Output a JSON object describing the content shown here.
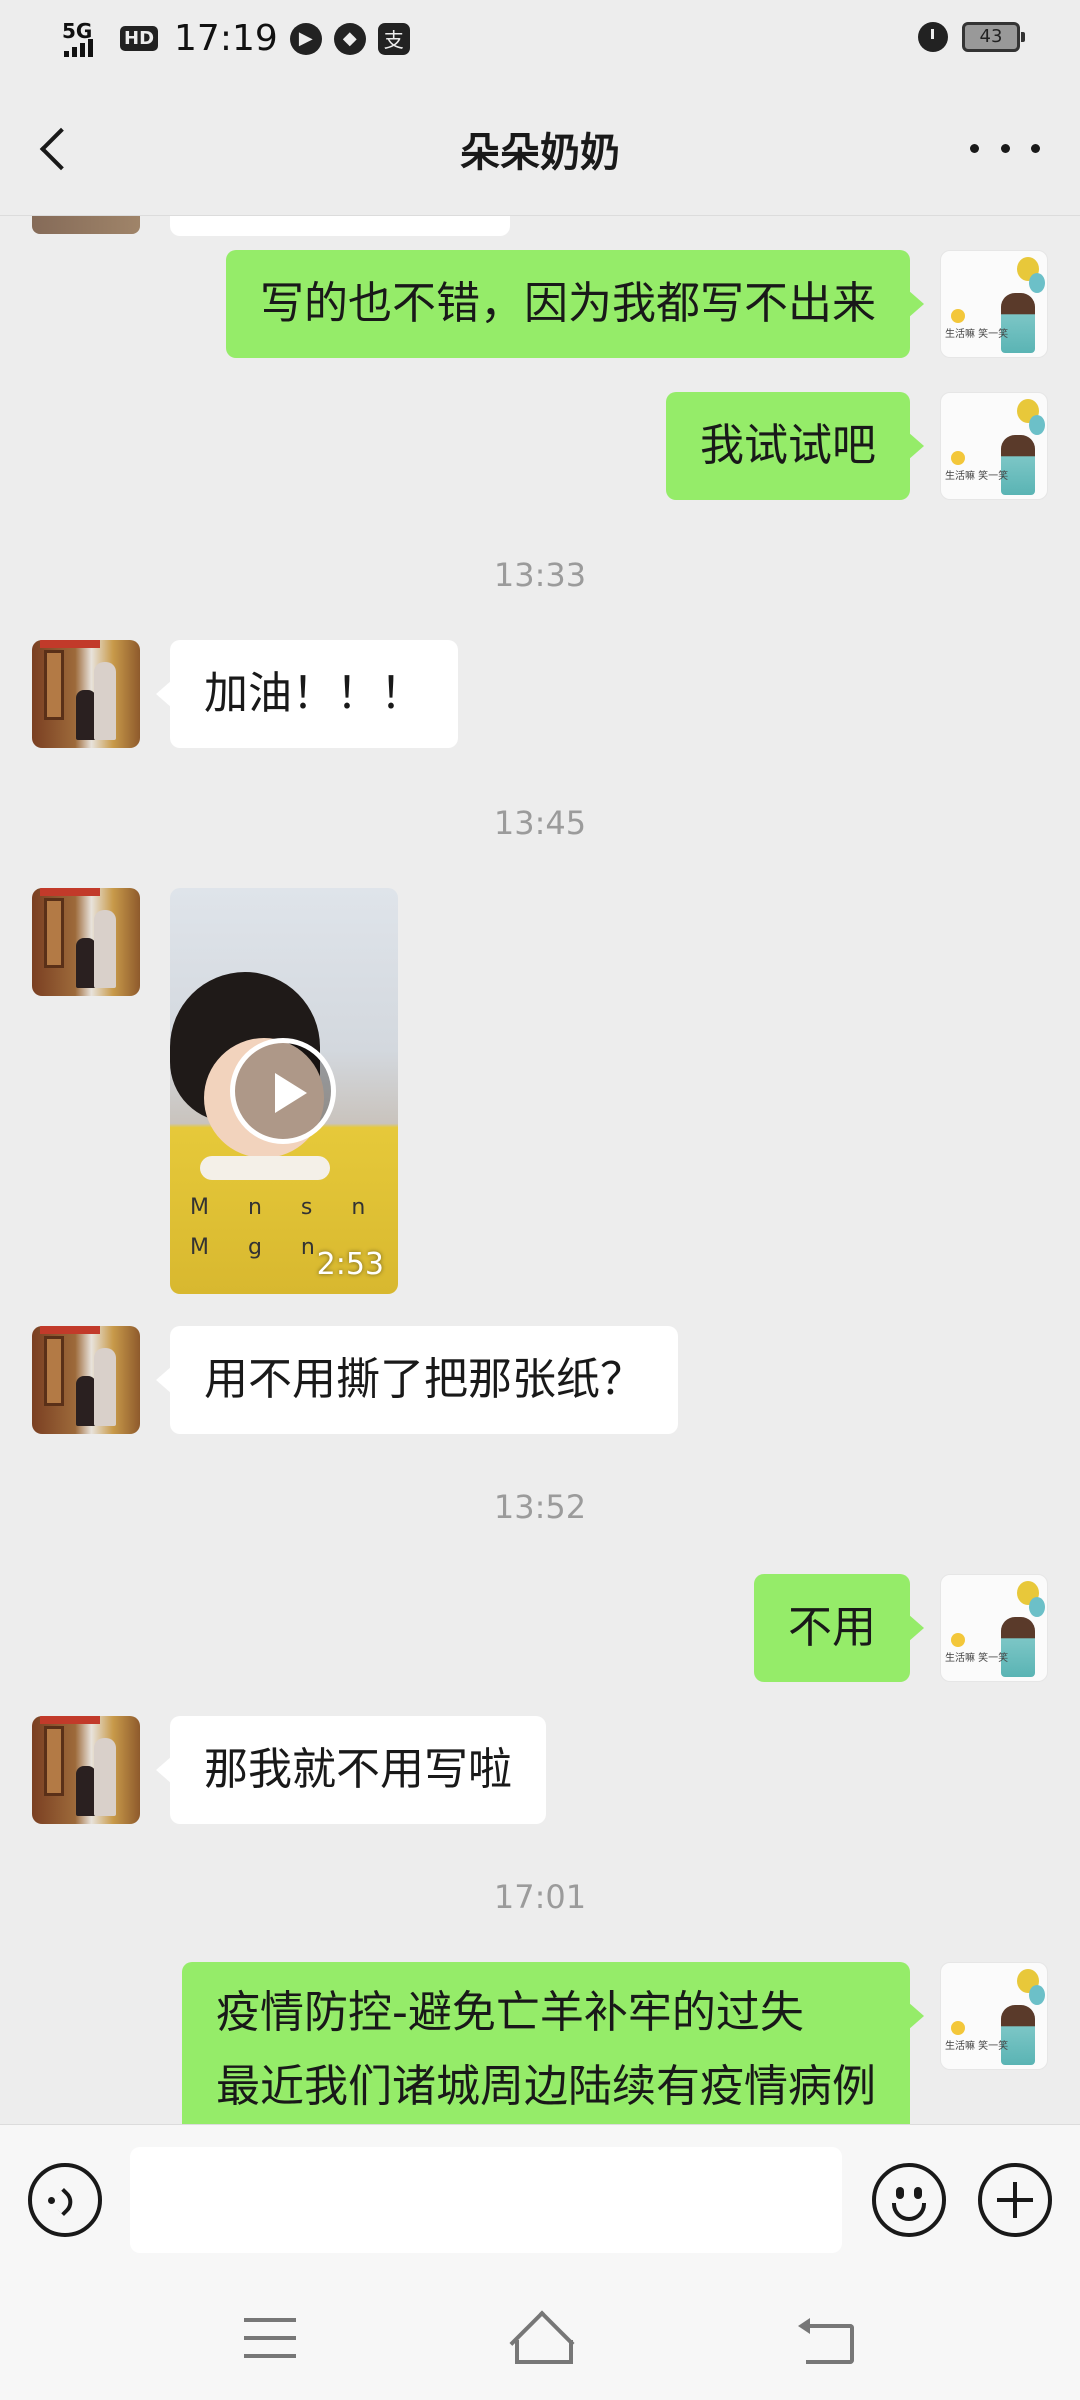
{
  "status_bar": {
    "network": "5G",
    "hd": "HD",
    "time": "17:19",
    "app_icon_glyph": "支",
    "battery": "43"
  },
  "header": {
    "title": "朵朵奶奶"
  },
  "messages": {
    "m1": "写的也不错，因为我都写不出来",
    "m2": "我试试吧",
    "t1": "13:33",
    "m3": "加油！！！",
    "t2": "13:45",
    "video_duration": "2:53",
    "m4": "用不用撕了把那张纸？",
    "t3": "13:52",
    "m5": "不用",
    "m6": "那我就不用写啦",
    "t4": "17:01",
    "m7_line1": "疫情防控-避免亡羊补牢的过失",
    "m7_line2": "最近我们诸城周边陆续有疫情病例"
  },
  "input": {
    "value": ""
  },
  "colors": {
    "background": "#ededed",
    "my_bubble": "#95ec69",
    "their_bubble": "#ffffff",
    "timestamp_text": "#9b9b9b"
  }
}
